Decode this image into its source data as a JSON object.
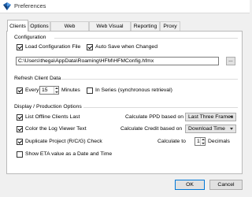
{
  "window": {
    "title": "Preferences"
  },
  "tabs": [
    {
      "label": "Clients",
      "active": true
    },
    {
      "label": "Options"
    },
    {
      "label": "Web Generation"
    },
    {
      "label": "Web Visual Styles"
    },
    {
      "label": "Reporting"
    },
    {
      "label": "Proxy"
    }
  ],
  "configuration": {
    "title": "Configuration",
    "load_config_label": "Load Configuration File",
    "load_config_checked": true,
    "auto_save_label": "Auto Save when Changed",
    "auto_save_checked": true,
    "config_path": "C:\\Users\\thega\\AppData\\Roaming\\HFM\\HFMConfig.hfmx",
    "browse_label": "..."
  },
  "refresh": {
    "title": "Refresh Client Data",
    "every_label": "Every",
    "every_checked": true,
    "minutes_value": "15",
    "minutes_label": "Minutes",
    "in_series_label": "In Series (synchronous retrieval)",
    "in_series_checked": false
  },
  "display": {
    "title": "Display / Production Options",
    "list_offline_label": "List Offline Clients Last",
    "list_offline_checked": true,
    "color_log_label": "Color the Log Viewer Text",
    "color_log_checked": true,
    "duplicate_label": "Duplicate Project (R/C/G) Check",
    "duplicate_checked": true,
    "show_eta_label": "Show ETA value as a Date and Time",
    "show_eta_checked": false,
    "ppd_label": "Calculate PPD based on",
    "ppd_value": "Last Three Frames",
    "credit_label": "Calculate Credit based on",
    "credit_value": "Download Time",
    "calc_to_label": "Calculate to",
    "calc_to_value": "1",
    "decimals_label": "Decimals"
  },
  "footer": {
    "ok_label": "OK",
    "cancel_label": "Cancel"
  },
  "colors": {
    "accent": "#0078d7",
    "panel": "#ffffff",
    "window": "#f0f0f0"
  }
}
